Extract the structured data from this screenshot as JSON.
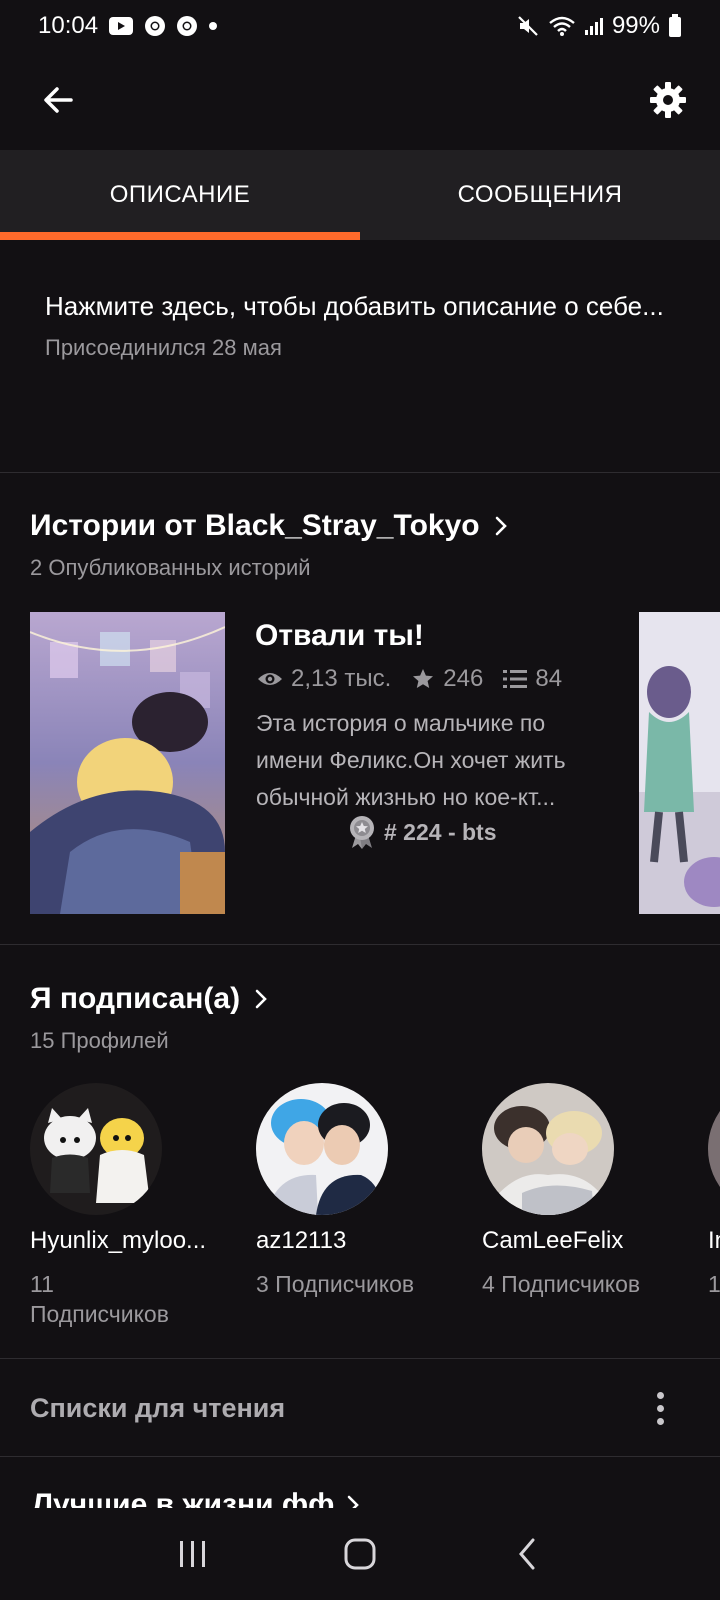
{
  "status_bar": {
    "time": "10:04",
    "battery": "99%"
  },
  "app_bar": {
    "back_icon": "arrow-left-icon",
    "settings_icon": "gear-icon"
  },
  "tabs": [
    {
      "label": "ОПИСАНИЕ",
      "active": true
    },
    {
      "label": "СООБЩЕНИЯ",
      "active": false
    }
  ],
  "about": {
    "placeholder": "Нажмите здесь, чтобы добавить описание о себе...",
    "joined": "Присоединился 28 мая"
  },
  "stories": {
    "title": "Истории от Black_Stray_Tokyo",
    "subtitle": "2 Опубликованных историй",
    "items": [
      {
        "title": "Отвали ты!",
        "reads": "2,13 тыс.",
        "votes": "246",
        "parts": "84",
        "description": "Эта история о мальчике по имени Феликс.Он хочет жить обычной жизнью но кое-кт...",
        "rank": "# 224 - bts"
      }
    ]
  },
  "following": {
    "title": "Я подписан(а)",
    "subtitle": "15 Профилей",
    "profiles": [
      {
        "name": "Hyunlix_myloo...",
        "followers": "11 Подписчиков"
      },
      {
        "name": "az12113",
        "followers": "3 Подписчиков"
      },
      {
        "name": "CamLeeFelix",
        "followers": "4 Подписчиков"
      },
      {
        "name": "In",
        "followers": "1"
      }
    ]
  },
  "reading_lists": {
    "title": "Списки для чтения"
  },
  "partial_list": {
    "title": "Лучшие в жизни фф"
  },
  "colors": {
    "accent": "#ff6a2b",
    "background": "#121013",
    "tab_bar": "#211f22"
  }
}
